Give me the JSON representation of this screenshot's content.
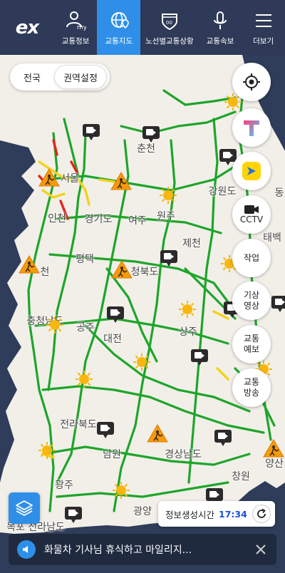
{
  "header": {
    "logo_text": "ex",
    "nav": [
      {
        "label": "교통정보",
        "icon": "my-profile-icon",
        "active": false
      },
      {
        "label": "교통지도",
        "icon": "globe-map-icon",
        "active": true
      },
      {
        "label": "노선별교통상황",
        "icon": "highway-shield-icon",
        "active": false
      },
      {
        "label": "교통속보",
        "icon": "microphone-icon",
        "active": false
      },
      {
        "label": "더보기",
        "icon": "hamburger-menu-icon",
        "active": false
      }
    ]
  },
  "map": {
    "region_toggle": {
      "all": "전국",
      "area": "권역설정"
    },
    "right_buttons": {
      "cctv": "CCTV",
      "work": "작업",
      "weather_video_1": "기상",
      "weather_video_2": "영상",
      "forecast_1": "교통",
      "forecast_2": "예보",
      "broadcast_1": "교통",
      "broadcast_2": "방송"
    },
    "cities": [
      {
        "name": "춘천"
      },
      {
        "name": "서울"
      },
      {
        "name": "강원도"
      },
      {
        "name": "인천"
      },
      {
        "name": "경기도"
      },
      {
        "name": "여주"
      },
      {
        "name": "원주"
      },
      {
        "name": "제천"
      },
      {
        "name": "태백"
      },
      {
        "name": "평택"
      },
      {
        "name": "청북도"
      },
      {
        "name": "천"
      },
      {
        "name": "충청남도"
      },
      {
        "name": "공주"
      },
      {
        "name": "대전"
      },
      {
        "name": "상주"
      },
      {
        "name": "전라북도"
      },
      {
        "name": "남원"
      },
      {
        "name": "경상남도"
      },
      {
        "name": "광주"
      },
      {
        "name": "창원"
      },
      {
        "name": "양산"
      },
      {
        "name": "광양"
      },
      {
        "name": "목포 전라남도"
      },
      {
        "name": "동"
      }
    ],
    "info_time_label": "정보생성시간",
    "info_time_value": "17:34",
    "notice_text": "화물차 기사님 휴식하고 마일리지...",
    "colors": {
      "road_green": "#1ea52a",
      "road_yellow": "#f2d21b",
      "road_red": "#e2261b",
      "land": "#f2efe9",
      "sea": "#2f3d5a",
      "accent": "#2f8fe8"
    }
  }
}
